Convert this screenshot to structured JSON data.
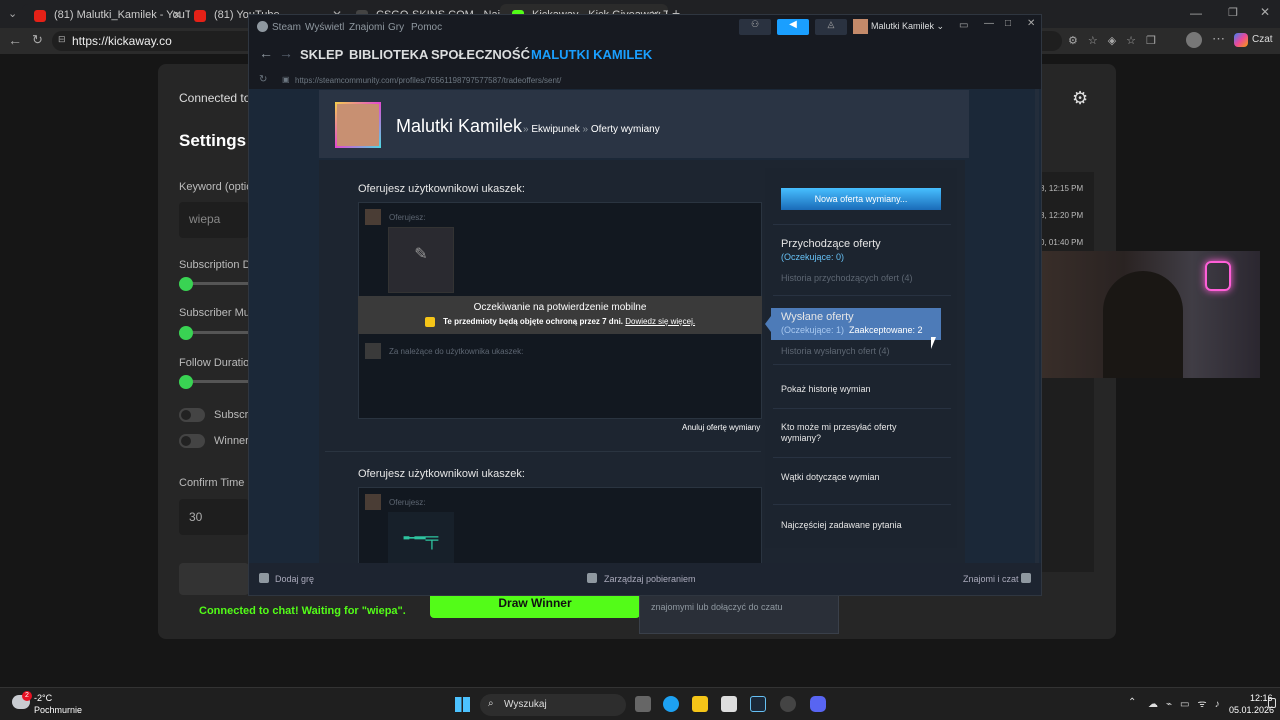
{
  "browser": {
    "tabs": [
      {
        "title": "(81) Malutki_Kamilek - YouTube"
      },
      {
        "title": "(81) YouTube"
      },
      {
        "title": "CSGO-SKINS.COM - Najlepsze Sk"
      },
      {
        "title": "Kickaway - Kick Giveaway Tool"
      }
    ],
    "url": "https://kickaway.co"
  },
  "kickaway": {
    "connected_to": "Connected to",
    "settings_title": "Settings",
    "keyword_label": "Keyword (optio",
    "keyword_value": "wiepa",
    "subscription_label": "Subscription Du",
    "subscriber_mult_label": "Subscriber Mult",
    "follow_duration_label": "Follow Duration",
    "toggle1_label": "Subscri",
    "toggle2_label": "Winner",
    "confirm_time_label": "Confirm Time (",
    "confirm_time_value": "30",
    "status_text": "Connected to chat! Waiting for \"wiepa\".",
    "draw_button": "Draw Winner",
    "chat_times": [
      "8, 12:15 PM",
      "8, 12:20 PM",
      "0, 01:40 PM"
    ],
    "chat_hint": "znajomymi lub dołączyć do czatu",
    "accent": "#53fc18"
  },
  "steam": {
    "menu": [
      "Steam",
      "Wyświetl",
      "Znajomi",
      "Gry",
      "Pomoc"
    ],
    "user": "Malutki Kamilek",
    "nav": [
      "SKLEP",
      "BIBLIOTEKA",
      "SPOŁECZNOŚĆ",
      "MALUTKI KAMILEK"
    ],
    "url": "https://steamcommunity.com/profiles/76561198797577587/tradeoffers/sent/",
    "profile_name": "Malutki Kamilek",
    "breadcrumb1": "Ekwipunek",
    "breadcrumb2": "Oferty wymiany",
    "offer1_title": "Oferujesz użytkownikowi ukaszek:",
    "offer1_you_offer": "Oferujesz:",
    "mobile_confirm": "Oczekiwanie na potwierdzenie mobilne",
    "protection_note": "Te przedmioty będą objęte ochroną przez 7 dni.",
    "learn_more": "Dowiedz się więcej.",
    "for_you": "Za należące do użytkownika ukaszek:",
    "cancel_offer": "Anuluj ofertę wymiany",
    "offer2_title": "Oferujesz użytkownikowi ukaszek:",
    "offer2_you_offer": "Oferujesz:",
    "new_offer_btn": "Nowa oferta wymiany...",
    "incoming_title": "Przychodzące oferty",
    "incoming_pending": "(Oczekujące: 0)",
    "incoming_history": "Historia przychodzących ofert (4)",
    "sent_title": "Wysłane oferty",
    "sent_pending": "(Oczekujące: 1)",
    "sent_accepted": "Zaakceptowane: 2",
    "sent_history": "Historia wysłanych ofert (4)",
    "trade_history": "Pokaż historię wymian",
    "who_can": "Kto może mi przesyłać oferty wymiany?",
    "threads": "Wątki dotyczące wymian",
    "faq": "Najczęściej zadawane pytania",
    "add_game": "Dodaj grę",
    "manage_downloads": "Zarządzaj pobieraniem",
    "friends_chat": "Znajomi i czat"
  },
  "taskbar": {
    "temp": "-2°C",
    "weather": "Pochmurnie",
    "search": "Wyszukaj",
    "time": "12:16",
    "date": "05.01.2026",
    "weather_badge": "2"
  }
}
